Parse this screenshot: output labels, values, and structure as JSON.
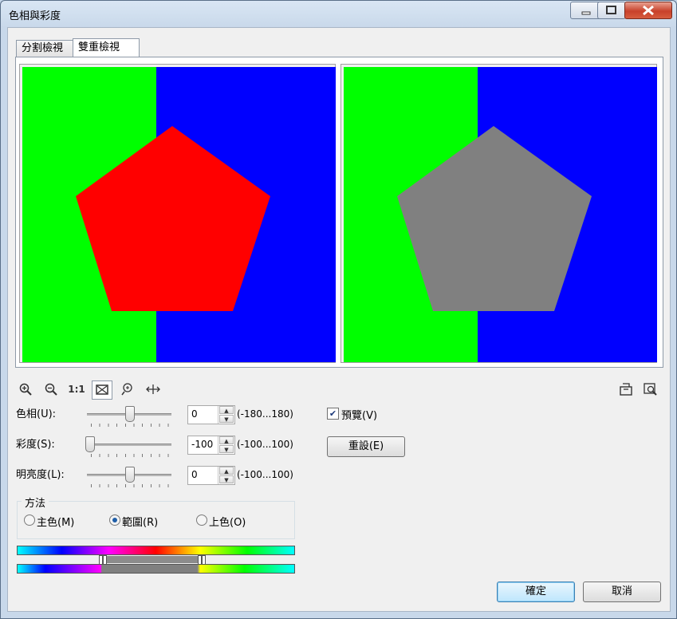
{
  "window": {
    "title": "色相與彩度"
  },
  "tabs": [
    {
      "label": "分割檢視"
    },
    {
      "label": "雙重檢視"
    }
  ],
  "toolbar": {
    "zoom_in_icon": "zoom-in-icon",
    "zoom_out_icon": "zoom-out-icon",
    "actual_size_label": "1:1",
    "fit_icon": "fit-window-icon",
    "zoom_tool_icon": "zoom-tool-icon",
    "pan_icon": "pan-icon"
  },
  "preview": {
    "left": {
      "bg_left": "#00ff00",
      "bg_right": "#0000ff",
      "shape": "#ff0000"
    },
    "right": {
      "bg_left": "#00ff00",
      "bg_right": "#0000ff",
      "shape": "#808080"
    }
  },
  "controls": {
    "hue": {
      "label": "色相(U):",
      "value": "0",
      "range": "(-180...180)",
      "level": 0.5
    },
    "saturation": {
      "label": "彩度(S):",
      "value": "-100",
      "range": "(-100...100)",
      "level": 0.0
    },
    "lightness": {
      "label": "明亮度(L):",
      "value": "0",
      "range": "(-100...100)",
      "level": 0.5
    }
  },
  "preview_checkbox": {
    "label": "預覽(V)",
    "checked": true
  },
  "reset_button": {
    "label": "重設(E)"
  },
  "method": {
    "title": "方法",
    "options": [
      {
        "label": "主色(M)",
        "selected": false
      },
      {
        "label": "範圍(R)",
        "selected": true
      },
      {
        "label": "上色(O)",
        "selected": false
      }
    ]
  },
  "ok_button": {
    "label": "確定"
  },
  "cancel_button": {
    "label": "取消"
  }
}
